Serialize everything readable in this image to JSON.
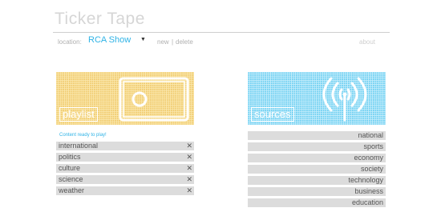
{
  "app": {
    "title": "Ticker Tape"
  },
  "location": {
    "label": "location:",
    "value": "RCA Show",
    "new_label": "new",
    "separator": "|",
    "delete_label": "delete"
  },
  "about_label": "about",
  "playlist": {
    "label": "playlist",
    "hint": "Content ready to play!",
    "items": [
      {
        "label": "international"
      },
      {
        "label": "politics"
      },
      {
        "label": "culture"
      },
      {
        "label": "science"
      },
      {
        "label": "weather"
      }
    ]
  },
  "sources": {
    "label": "sources",
    "items": [
      {
        "label": "national"
      },
      {
        "label": "sports"
      },
      {
        "label": "economy"
      },
      {
        "label": "society"
      },
      {
        "label": "technology"
      },
      {
        "label": "business"
      },
      {
        "label": "education"
      }
    ]
  },
  "icons": {
    "remove": "close-icon",
    "location_caret": "caret-down-icon",
    "playlist_art": "tv-screen-icon",
    "sources_art": "broadcast-antenna-icon"
  },
  "colors": {
    "accent": "#2fb3e6",
    "playlist_tile": "#efc869",
    "sources_tile": "#67cdf1",
    "list_item_bg": "#dcdcdc",
    "title": "#d6d6d6"
  }
}
